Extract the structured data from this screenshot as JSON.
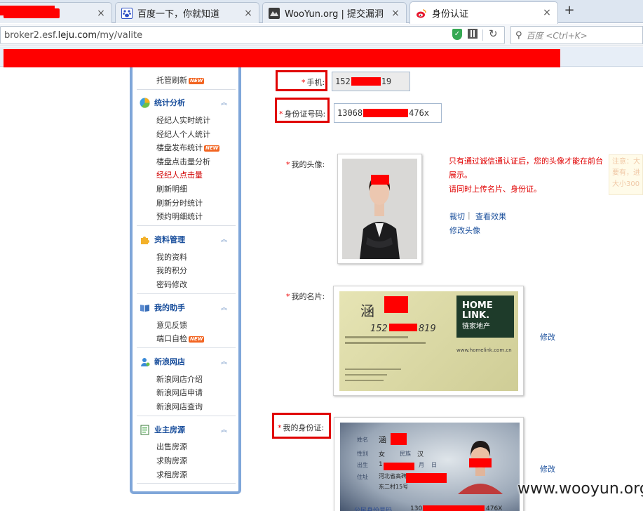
{
  "tabs": [
    {
      "label": "",
      "close": "×",
      "favicon": "redacted-tab-icon"
    },
    {
      "label": "百度一下，你就知道",
      "close": "×",
      "favicon": "baidu-paw-icon"
    },
    {
      "label": "WooYun.org | 提交漏洞",
      "close": "×",
      "favicon": "wooyun-icon"
    },
    {
      "label": "身份认证",
      "close": "×",
      "favicon": "sina-weibo-icon"
    }
  ],
  "new_tab": "+",
  "address": {
    "prefix": "broker2.esf.",
    "domain": "leju.com",
    "path": "/my/valite"
  },
  "search": {
    "placeholder": "百度 <Ctrl+K>"
  },
  "sidebar": {
    "top_item": {
      "label": "托管刷新",
      "badge": "NEW"
    },
    "sections": [
      {
        "title": "统计分析",
        "items": [
          {
            "label": "经纪人实时统计"
          },
          {
            "label": "经纪人个人统计"
          },
          {
            "label": "楼盘发布统计",
            "badge": "NEW"
          },
          {
            "label": "楼盘点击量分析"
          },
          {
            "label": "经纪人点击量",
            "active": true
          },
          {
            "label": "刷新明细"
          },
          {
            "label": "刷新分时统计"
          },
          {
            "label": "预约明细统计"
          }
        ]
      },
      {
        "title": "资料管理",
        "items": [
          {
            "label": "我的资料"
          },
          {
            "label": "我的积分"
          },
          {
            "label": "密码修改"
          }
        ]
      },
      {
        "title": "我的助手",
        "items": [
          {
            "label": "意见反馈"
          },
          {
            "label": "端口自检",
            "badge": "NEW"
          }
        ]
      },
      {
        "title": "新浪网店",
        "items": [
          {
            "label": "新浪网店介绍"
          },
          {
            "label": "新浪网店申请"
          },
          {
            "label": "新浪网店查询"
          }
        ]
      },
      {
        "title": "业主房源",
        "items": [
          {
            "label": "出售房源"
          },
          {
            "label": "求购房源"
          },
          {
            "label": "求租房源"
          }
        ]
      }
    ],
    "chevron": "︽"
  },
  "form": {
    "required_mark": "*",
    "phone": {
      "label": "手机:",
      "prefix": "152",
      "suffix": "19"
    },
    "idcard": {
      "label": "身份证号码:",
      "prefix": "13068",
      "suffix": "476x"
    },
    "avatar": {
      "label": "我的头像:",
      "note_line1": "只有通过诚信通认证后，您的头像才能在前台",
      "note_line2": "展示。",
      "note_line3": "请同时上传名片、身份证。",
      "crop": "裁切",
      "separator": "|",
      "view": "查看效果",
      "edit": "修改头像"
    },
    "card": {
      "label": "我的名片:",
      "edit": "修改",
      "brand_line1": "HOME",
      "brand_line2": "LINK.",
      "brand_cn": "链家地产",
      "surname": "涵",
      "phone_prefix": "152",
      "phone_suffix": "819",
      "website": "www.homelink.com.cn"
    },
    "id": {
      "label": "我的身份证:",
      "edit": "修改",
      "field_name": "姓名",
      "field_gender": "性别",
      "field_birth": "出生",
      "field_address": "住址",
      "field_idnum": "公民身份号码",
      "name_char": "涵",
      "gender_val": "女",
      "ethnic_label": "民族",
      "ethnic_val": "汉",
      "birth_prefix": "1",
      "birth_m": "月",
      "birth_d": "日",
      "address_line1": "河北省高碑",
      "address_line2": "东二村15号",
      "idnum_prefix": "130",
      "idnum_suffix": "476X"
    }
  },
  "ghost_tip": {
    "line1": "注意：大",
    "line2": "要有，进",
    "line3": "大小300"
  },
  "watermark": "www.wooyun.org",
  "colors": {
    "highlight": "#e00000",
    "accent": "#1a4f9c",
    "redaction": "#ff0000",
    "sidebar_border": "#7fa6d9"
  }
}
